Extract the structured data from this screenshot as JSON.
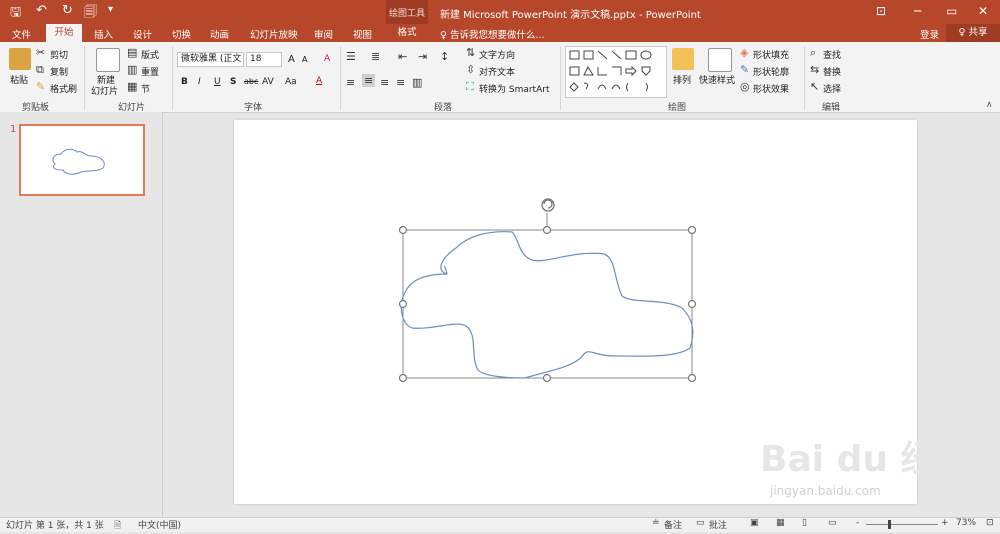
{
  "titlebar": {
    "qat_save": "🖫",
    "qat_undo": "↶",
    "qat_redo": "↻",
    "qat_start": "🗐",
    "qat_more": "▾",
    "tools_label": "绘图工具",
    "doc_title": "新建 Microsoft PowerPoint 演示文稿.pptx - PowerPoint",
    "win_ribbon": "⊡",
    "win_min": "─",
    "win_max": "▭",
    "win_close": "✕"
  },
  "tabs": {
    "file": "文件",
    "home": "开始",
    "insert": "插入",
    "design": "设计",
    "transitions": "切换",
    "animations": "动画",
    "slideshow": "幻灯片放映",
    "review": "审阅",
    "view": "视图",
    "format": "格式",
    "tell_me": "♀ 告诉我您想要做什么...",
    "login": "登录",
    "share": "♀ 共享"
  },
  "ribbon": {
    "clipboard": {
      "paste": "粘贴",
      "cut": "剪切",
      "copy": "复制",
      "painter": "格式刷",
      "label": "剪贴板"
    },
    "slides": {
      "new_slide_1": "新建",
      "new_slide_2": "幻灯片",
      "layout": "版式",
      "reset": "重置",
      "section": "节",
      "label": "幻灯片"
    },
    "font": {
      "font_name": "微软雅黑 (正文",
      "font_size": "18",
      "grow": "A",
      "shrink": "A",
      "clear": "A",
      "bold": "B",
      "italic": "I",
      "underline": "U",
      "shadow": "S",
      "strike": "abc",
      "spacing": "AV",
      "case": "Aa",
      "color": "A",
      "label": "字体"
    },
    "paragraph": {
      "text_direction": "文字方向",
      "align_text": "对齐文本",
      "smartart": "转换为 SmartArt",
      "label": "段落"
    },
    "drawing": {
      "arrange": "排列",
      "quick_styles": "快速样式",
      "fill": "形状填充",
      "outline": "形状轮廓",
      "effects": "形状效果",
      "label": "绘图"
    },
    "editing": {
      "find": "查找",
      "replace": "替换",
      "select": "选择",
      "label": "编辑"
    }
  },
  "slides_pane": {
    "thumb_number": "1"
  },
  "status": {
    "slide_info": "幻灯片 第 1 张，共 1 张",
    "language": "中文(中国)",
    "notes": "备注",
    "comments": "批注",
    "zoom": "73%",
    "zoom_minus": "-",
    "zoom_plus": "+"
  },
  "watermark": {
    "brand": "Bai du 经验",
    "url": "jingyan.baidu.com"
  },
  "colors": {
    "accent": "#b7472a",
    "shape_stroke": "#6a8fc0",
    "thumb_border": "#e07a53"
  }
}
